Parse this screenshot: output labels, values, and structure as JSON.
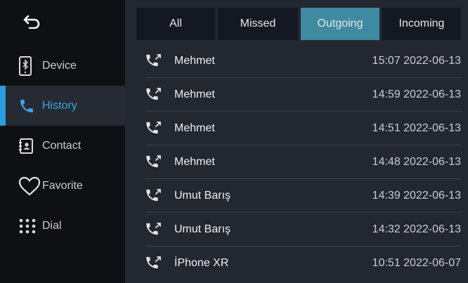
{
  "sidebar": {
    "items": [
      {
        "label": "Device",
        "icon": "bluetooth-phone-icon"
      },
      {
        "label": "History",
        "icon": "phone-icon",
        "active": true
      },
      {
        "label": "Contact",
        "icon": "contact-book-icon"
      },
      {
        "label": "Favorite",
        "icon": "heart-icon"
      },
      {
        "label": "Dial",
        "icon": "keypad-icon"
      }
    ]
  },
  "tabs": [
    {
      "label": "All"
    },
    {
      "label": "Missed"
    },
    {
      "label": "Outgoing",
      "active": true
    },
    {
      "label": "Incoming"
    }
  ],
  "calls": [
    {
      "name": "Mehmet",
      "time": "15:07 2022-06-13"
    },
    {
      "name": "Mehmet",
      "time": "14:59 2022-06-13"
    },
    {
      "name": "Mehmet",
      "time": "14:51 2022-06-13"
    },
    {
      "name": "Mehmet",
      "time": "14:48 2022-06-13"
    },
    {
      "name": "Umut Barış",
      "time": "14:39 2022-06-13"
    },
    {
      "name": "Umut Barış",
      "time": "14:32 2022-06-13"
    },
    {
      "name": "İPhone XR",
      "time": "10:51 2022-06-07"
    }
  ],
  "colors": {
    "accent": "#2c9ee0",
    "active_tab": "#3f8aa1",
    "background": "#23272f"
  }
}
